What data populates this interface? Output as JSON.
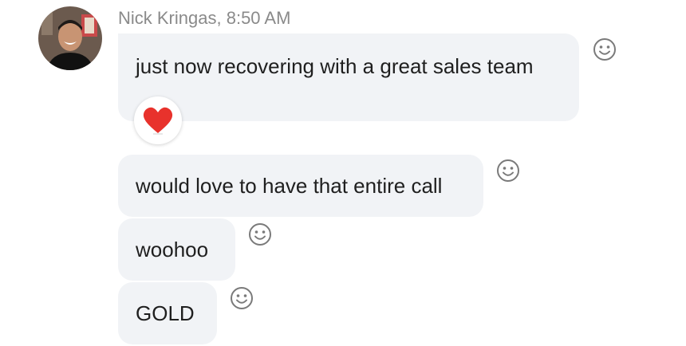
{
  "message_group": {
    "sender_name": "Nick Kringas",
    "timestamp": "8:50 AM",
    "header_separator": ", ",
    "messages": [
      {
        "text": "just now recovering with a great sales team",
        "reaction": "heart-icon"
      },
      {
        "text": "would love to have that entire call"
      },
      {
        "text": "woohoo"
      },
      {
        "text": "GOLD"
      }
    ]
  },
  "colors": {
    "bubble_bg": "#f1f3f6",
    "meta_text": "#8a8a8a",
    "message_text": "#1f1f1f",
    "reaction_heart": "#e8322c",
    "emoji_icon_stroke": "#7a7a7a"
  }
}
